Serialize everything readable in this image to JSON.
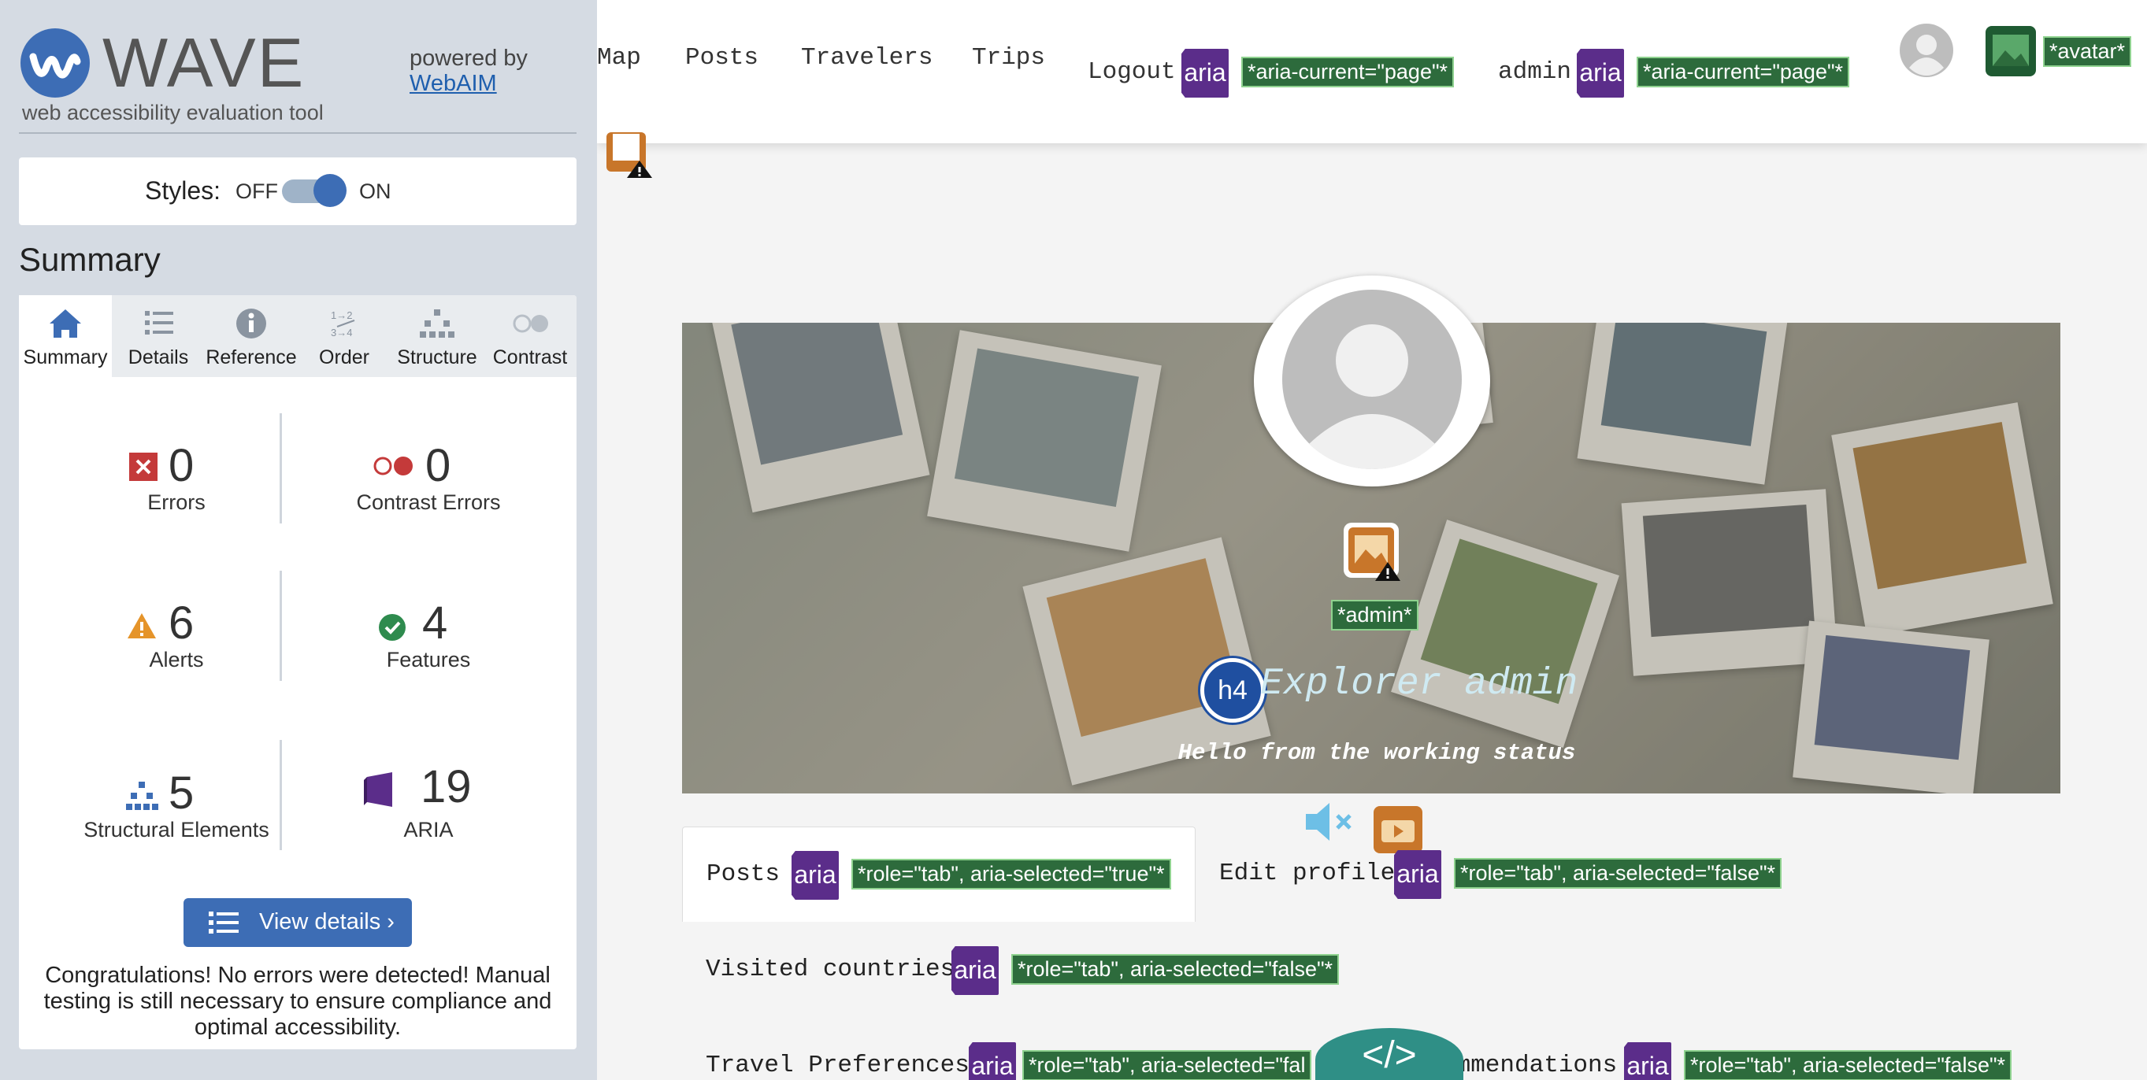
{
  "wave": {
    "title": "WAVE",
    "subtitle": "web accessibility evaluation tool",
    "powered_by": "powered by",
    "webaim_link": "WebAIM",
    "styles_label": "Styles:",
    "styles_off": "OFF",
    "styles_on": "ON",
    "styles_enabled": true,
    "summary_heading": "Summary",
    "tabs": [
      {
        "label": "Summary",
        "icon": "home-icon",
        "active": true
      },
      {
        "label": "Details",
        "icon": "list-icon",
        "active": false
      },
      {
        "label": "Reference",
        "icon": "info-icon",
        "active": false
      },
      {
        "label": "Order",
        "icon": "order-icon",
        "active": false
      },
      {
        "label": "Structure",
        "icon": "structure-icon",
        "active": false
      },
      {
        "label": "Contrast",
        "icon": "contrast-icon",
        "active": false
      }
    ],
    "stats": {
      "errors": {
        "count": "0",
        "label": "Errors"
      },
      "contrast_errors": {
        "count": "0",
        "label": "Contrast Errors"
      },
      "alerts": {
        "count": "6",
        "label": "Alerts"
      },
      "features": {
        "count": "4",
        "label": "Features"
      },
      "structural": {
        "count": "5",
        "label": "Structural Elements"
      },
      "aria": {
        "count": "19",
        "label": "ARIA"
      }
    },
    "view_details_label": "View details ›",
    "congrats": "Congratulations! No errors were detected! Manual testing is still necessary to ensure compliance and optimal accessibility.",
    "colors": {
      "error": "#c43a3a",
      "alert": "#e5942a",
      "feature": "#2e8b4e",
      "structure": "#3d6db5",
      "aria": "#5b2d8a"
    }
  },
  "page": {
    "nav": {
      "map": "Map",
      "posts": "Posts",
      "travelers": "Travelers",
      "trips": "Trips",
      "logout": "Logout",
      "admin": "admin",
      "aria_badge": "aria",
      "aria_current_1": "*aria-current=\"page\"*",
      "aria_current_2": "*aria-current=\"page\"*",
      "avatar_label": "*avatar*"
    },
    "profile": {
      "alt_label": "*admin*",
      "heading_badge": "h4",
      "name": "Explorer admin",
      "status": "Hello from the working status"
    },
    "tabs": {
      "posts": "Posts",
      "posts_attr": "*role=\"tab\", aria-selected=\"true\"*",
      "edit_profile": "Edit profile",
      "edit_profile_attr": "*role=\"tab\", aria-selected=\"false\"*",
      "visited": "Visited countries",
      "visited_attr": "*role=\"tab\", aria-selected=\"false\"*",
      "travel_prefs": "Travel Preferences",
      "travel_prefs_attr": "*role=\"tab\", aria-selected=\"fal",
      "recommendations": "ommendations",
      "recommendations_attr": "*role=\"tab\", aria-selected=\"false\"*"
    },
    "code_toggle": "</>"
  }
}
